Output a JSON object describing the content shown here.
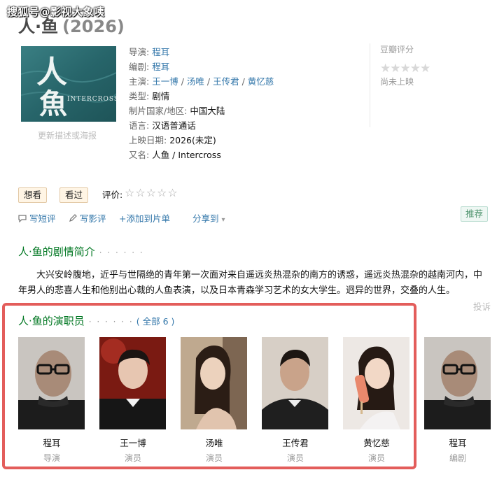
{
  "watermark": "搜狐号@影视大象咦",
  "movie": {
    "title": "人·鱼",
    "year": "(2026)"
  },
  "poster": {
    "text_line1": "人",
    "text_line2": "魚",
    "caption": "INTERCROSS",
    "update_link": "更新描述或海报"
  },
  "info": {
    "director_label": "导演:",
    "director": "程耳",
    "writer_label": "编剧:",
    "writer": "程耳",
    "cast_label": "主演:",
    "cast": [
      "王一博",
      "汤唯",
      "王传君",
      "黄忆慈"
    ],
    "cast_sep": " / ",
    "genre_label": "类型:",
    "genre": "剧情",
    "region_label": "制片国家/地区:",
    "region": "中国大陆",
    "language_label": "语言:",
    "language": "汉语普通话",
    "release_label": "上映日期:",
    "release": "2026(未定)",
    "aka_label": "又名:",
    "aka": "人鱼 / Intercross"
  },
  "rating": {
    "label": "豆瓣评分",
    "stars": "★★★★★",
    "status": "尚未上映"
  },
  "interest": {
    "want": "想看",
    "seen": "看过",
    "rate_label": "评价:",
    "rate_stars": "☆☆☆☆☆"
  },
  "actions": {
    "short_review": "写短评",
    "review": "写影评",
    "add_list": "+添加到片单",
    "share": "分享到",
    "share_caret": "▾",
    "recommend": "推荐"
  },
  "summary": {
    "title": "人·鱼的剧情简介",
    "dots": "· · · · · ·",
    "text": "大兴安岭腹地，近乎与世隔绝的青年第一次面对来自遥远炎热混杂的南方的诱惑，遥远炎热混杂的越南河内，中年男人的悲喜人生和他别出心裁的人鱼表演，以及日本青森学习艺术的女大学生。迥异的世界，交叠的人生。",
    "report": "投诉"
  },
  "cast_section": {
    "title": "人·鱼的演职员",
    "dots": "· · · · · ·",
    "all": "( 全部 6 )",
    "members": [
      {
        "name": "程耳",
        "role": "导演"
      },
      {
        "name": "王一博",
        "role": "演员"
      },
      {
        "name": "汤唯",
        "role": "演员"
      },
      {
        "name": "王传君",
        "role": "演员"
      },
      {
        "name": "黄忆慈",
        "role": "演员"
      },
      {
        "name": "程耳",
        "role": "编剧"
      }
    ]
  },
  "colors": {
    "link": "#3377aa",
    "section": "#007722",
    "highlight_frame": "#e35d5b"
  }
}
